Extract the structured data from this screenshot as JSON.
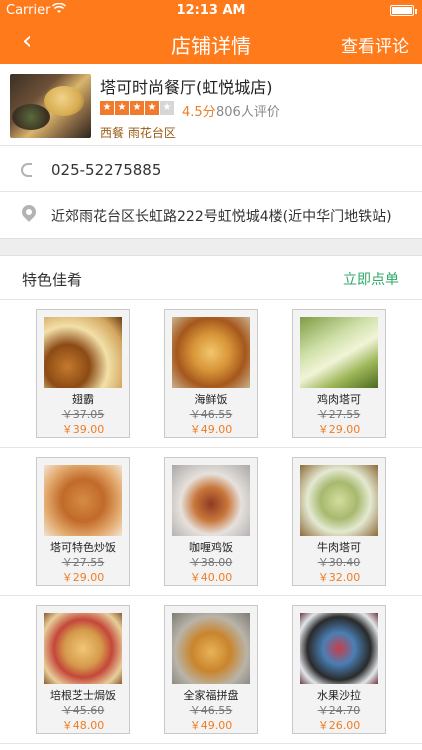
{
  "status_bar": {
    "carrier": "Carrier",
    "time": "12:13 AM"
  },
  "nav": {
    "back_icon": "‹",
    "title": "店铺详情",
    "right_action": "查看评论"
  },
  "shop": {
    "name": "塔可时尚餐厅(虹悦城店)",
    "rating": 4.5,
    "rating_text": "4.5分",
    "reviews_text": "806人评价",
    "tags": "西餐  雨花台区"
  },
  "contact": {
    "phone": "025-52275885",
    "address": "近郊雨花台区长虹路222号虹悦城4楼(近中华门地铁站)"
  },
  "section": {
    "title": "特色佳肴",
    "action": "立即点单"
  },
  "dishes": [
    {
      "name": "翅霸",
      "old_price": "￥37.05",
      "price": "￥39.00"
    },
    {
      "name": "海鲜饭",
      "old_price": "￥46.55",
      "price": "￥49.00"
    },
    {
      "name": "鸡肉塔可",
      "old_price": "￥27.55",
      "price": "￥29.00"
    },
    {
      "name": "塔可特色炒饭",
      "old_price": "￥27.55",
      "price": "￥29.00"
    },
    {
      "name": "咖喱鸡饭",
      "old_price": "￥38.00",
      "price": "￥40.00"
    },
    {
      "name": "牛肉塔可",
      "old_price": "￥30.40",
      "price": "￥32.00"
    },
    {
      "name": "培根芝士焗饭",
      "old_price": "￥45.60",
      "price": "￥48.00"
    },
    {
      "name": "全家福拼盘",
      "old_price": "￥46.55",
      "price": "￥49.00"
    },
    {
      "name": "水果沙拉",
      "old_price": "￥24.70",
      "price": "￥26.00"
    }
  ],
  "colors": {
    "brand": "#ff7a1a",
    "price": "#ef7d25",
    "action": "#2eaa6a"
  }
}
